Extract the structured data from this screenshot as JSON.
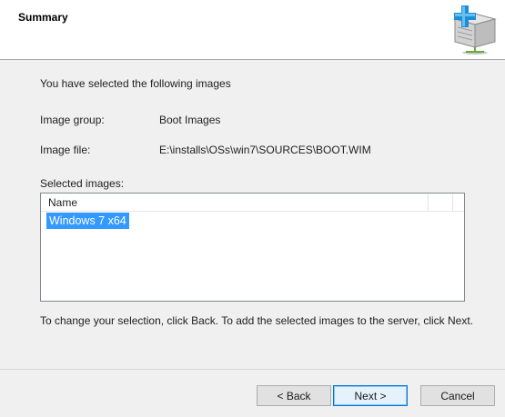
{
  "header": {
    "title": "Summary",
    "icon": "server-add-icon"
  },
  "content": {
    "intro": "You have selected the following images",
    "image_group_label": "Image group:",
    "image_group_value": "Boot Images",
    "image_file_label": "Image file:",
    "image_file_value": "E:\\installs\\OSs\\win7\\SOURCES\\BOOT.WIM",
    "selected_images_label": "Selected images:",
    "list": {
      "columns": [
        "Name"
      ],
      "items": [
        {
          "name": "Windows 7 x64",
          "selected": true
        }
      ]
    },
    "help_text": "To change your selection, click Back. To add the selected images to the server, click Next."
  },
  "buttons": {
    "back": "< Back",
    "next": "Next >",
    "cancel": "Cancel"
  },
  "colors": {
    "selection": "#3399ff",
    "default_button_border": "#0078d7",
    "header_bg": "#ffffff",
    "body_bg": "#f0f0f0"
  }
}
